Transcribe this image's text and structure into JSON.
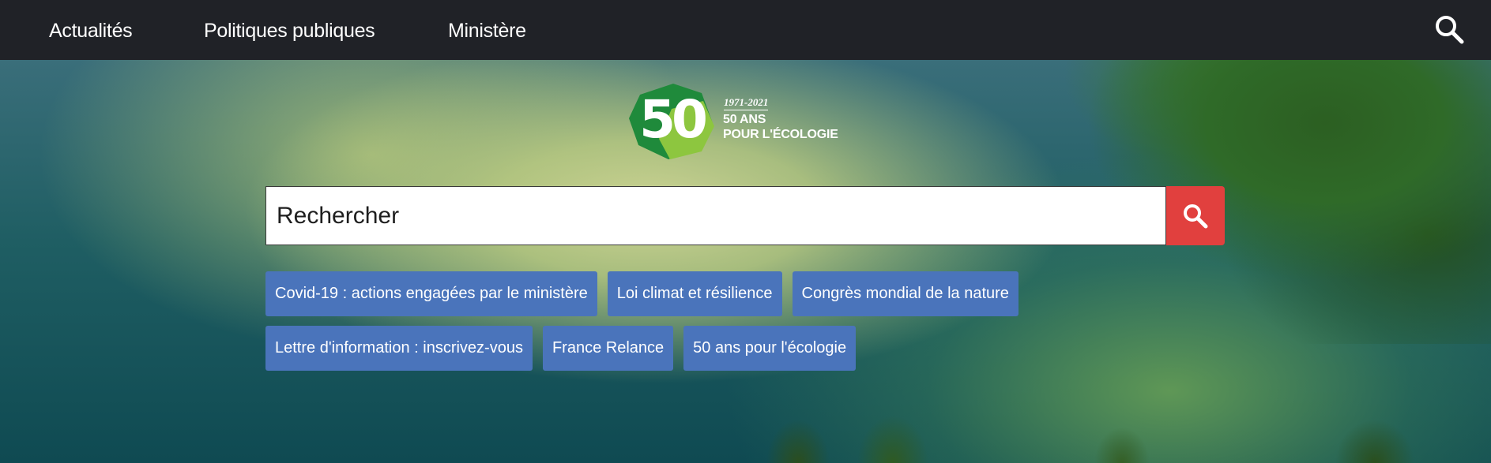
{
  "nav": {
    "items": [
      {
        "label": "Actualités"
      },
      {
        "label": "Politiques publiques"
      },
      {
        "label": "Ministère"
      }
    ],
    "search_icon": "search-icon"
  },
  "logo": {
    "number": "50",
    "years": "1971-2021",
    "line1": "50 ANS",
    "line2": "POUR L'ÉCOLOGIE"
  },
  "search": {
    "placeholder": "Rechercher",
    "button_icon": "search-icon"
  },
  "quick_links": {
    "row1": [
      {
        "label": "Covid-19 : actions engagées par le ministère"
      },
      {
        "label": "Loi climat et résilience"
      },
      {
        "label": "Congrès mondial de la nature"
      }
    ],
    "row2": [
      {
        "label": "Lettre d'information : inscrivez-vous"
      },
      {
        "label": "France Relance"
      },
      {
        "label": "50 ans pour l'écologie"
      }
    ]
  },
  "colors": {
    "nav_bg": "#202227",
    "search_button": "#e1403e",
    "quick_link": "#4a74bb",
    "logo_green_dark": "#1f8a3b",
    "logo_green_light": "#8dc63f"
  }
}
